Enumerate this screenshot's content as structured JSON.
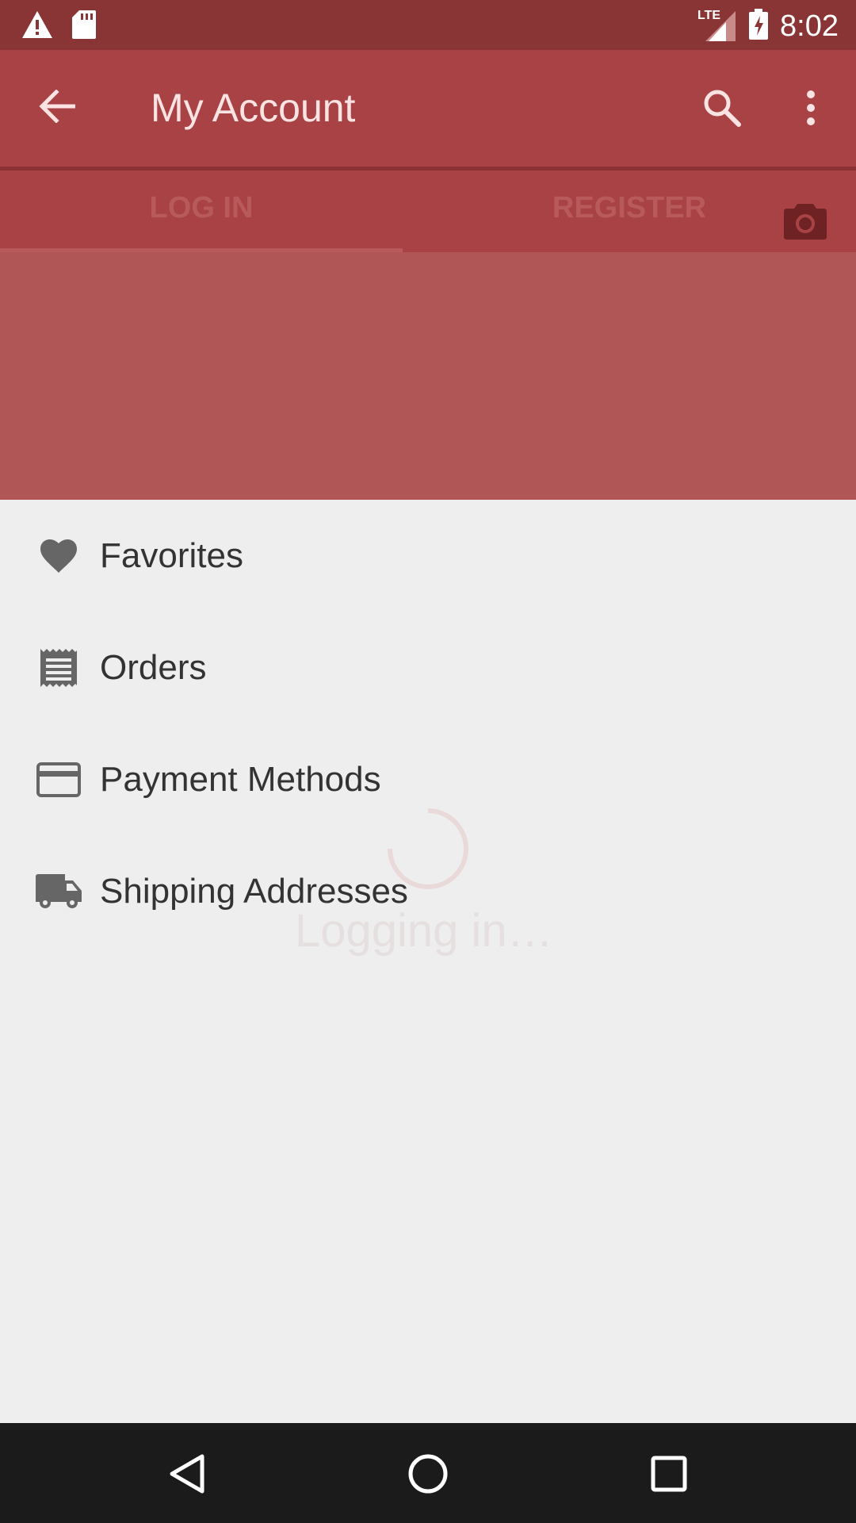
{
  "status_bar": {
    "time": "8:02",
    "network": "LTE",
    "icons": [
      "warning-icon",
      "sd-card-icon",
      "lte-signal-icon",
      "battery-charging-icon"
    ]
  },
  "app_bar": {
    "title": "My Account",
    "icons": [
      "back-arrow-icon",
      "search-icon",
      "more-vert-icon"
    ]
  },
  "tabs": [
    {
      "label": "LOG IN",
      "selected": true
    },
    {
      "label": "REGISTER",
      "selected": false
    }
  ],
  "camera_icon": "camera-icon",
  "menu": {
    "items": [
      {
        "label": "Favorites",
        "icon": "heart-icon"
      },
      {
        "label": "Orders",
        "icon": "receipt-icon"
      },
      {
        "label": "Payment Methods",
        "icon": "credit-card-icon"
      },
      {
        "label": "Shipping Addresses",
        "icon": "truck-icon"
      }
    ]
  },
  "loading": {
    "text": "Logging in…"
  },
  "nav_bar": {
    "icons": [
      "back-triangle-icon",
      "home-circle-icon",
      "recents-square-icon"
    ]
  },
  "colors": {
    "status_bar": "#8a3535",
    "app_bar": "#a84244",
    "header_panel": "#b05656",
    "background": "#eeeeee",
    "nav_bar": "#1b1b1b"
  }
}
